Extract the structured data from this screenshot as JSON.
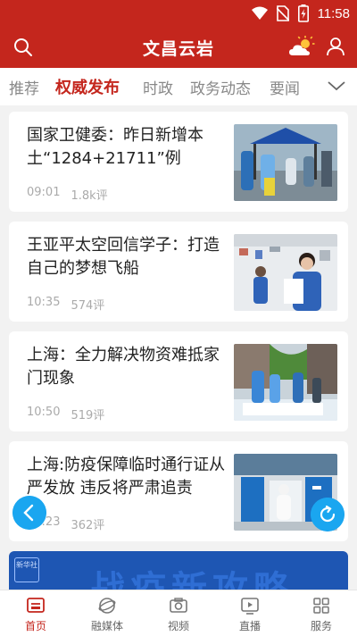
{
  "status_bar": {
    "time": "11:58"
  },
  "header": {
    "title": "文昌云岩"
  },
  "tabs": [
    {
      "label": "推荐"
    },
    {
      "label": "权威发布"
    },
    {
      "label": "时政"
    },
    {
      "label": "政务动态"
    },
    {
      "label": "要闻"
    }
  ],
  "active_tab": "权威发布",
  "news": [
    {
      "headline": "国家卫健委：昨日新增本土“1284+21711”例",
      "time": "09:01",
      "comments": "1.8k评"
    },
    {
      "headline": "王亚平太空回信学子：打造自己的梦想飞船",
      "time": "10:35",
      "comments": "574评"
    },
    {
      "headline": "上海：全力解决物资难抵家门现象",
      "time": "10:50",
      "comments": "519评"
    },
    {
      "headline": "上海:防疫保障临时通行证从严发放 违反将严肃追责",
      "time": "10:23",
      "comments": "362评"
    }
  ],
  "banner": {
    "logo_text": "新华社",
    "text": "战疫新攻略"
  },
  "bottom_nav": [
    {
      "label": "首页"
    },
    {
      "label": "融媒体"
    },
    {
      "label": "视频"
    },
    {
      "label": "直播"
    },
    {
      "label": "服务"
    }
  ],
  "colors": {
    "brand": "#c4261d",
    "fab": "#1aa6f0",
    "banner": "#1e56b3"
  }
}
